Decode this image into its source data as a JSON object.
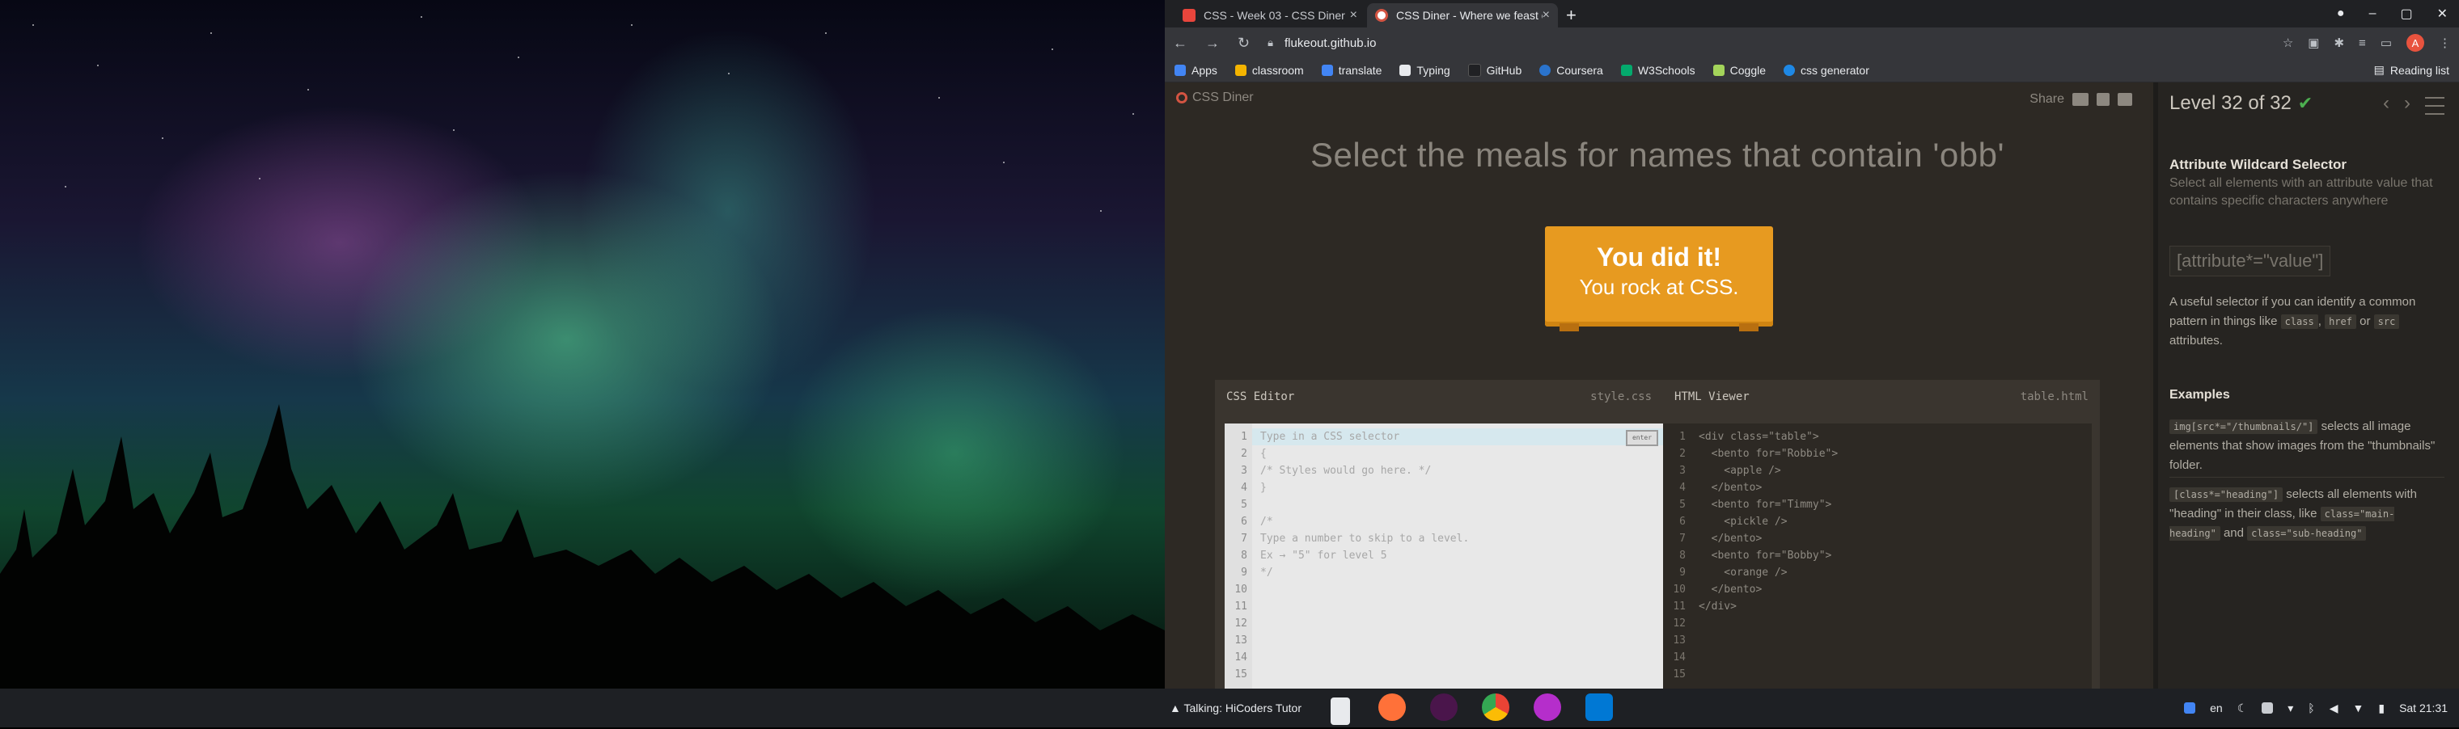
{
  "tabs": [
    {
      "title": "CSS - Week 03 - CSS Diner",
      "color": "#e8453c"
    },
    {
      "title": "CSS Diner - Where we feast on CSS",
      "color": "#d35442"
    }
  ],
  "toolbar": {
    "url": "flukeout.github.io",
    "avatar_letter": "A"
  },
  "bookmarks": [
    {
      "label": "Apps",
      "color": "#4285f4"
    },
    {
      "label": "classroom",
      "color": "#f4b400"
    },
    {
      "label": "translate",
      "color": "#4285f4"
    },
    {
      "label": "Typing",
      "color": "#e8eaed"
    },
    {
      "label": "GitHub",
      "color": "#202124"
    },
    {
      "label": "Coursera",
      "color": "#2a73cc"
    },
    {
      "label": "W3Schools",
      "color": "#04aa6d"
    },
    {
      "label": "Coggle",
      "color": "#a3d45a"
    },
    {
      "label": "css generator",
      "color": "#1e88e5"
    }
  ],
  "reading_list": "Reading list",
  "game": {
    "logo": "CSS Diner",
    "share": "Share",
    "order": "Select the meals for names that contain 'obb'",
    "win_line1": "You did it!",
    "win_line2": "You rock at CSS."
  },
  "editor": {
    "css_title": "CSS Editor",
    "css_file": "style.css",
    "html_title": "HTML Viewer",
    "html_file": "table.html",
    "enter_label": "enter",
    "css_lines": [
      "Type in a CSS selector",
      "{",
      "/* Styles would go here. */",
      "}",
      "",
      "/*",
      "Type a number to skip to a level.",
      "Ex → \"5\" for level 5",
      "*/",
      "",
      "",
      "",
      "",
      "",
      ""
    ],
    "html_lines": [
      "<div class=\"table\">",
      "  <bento for=\"Robbie\">",
      "    <apple />",
      "  </bento>",
      "  <bento for=\"Timmy\">",
      "    <pickle />",
      "  </bento>",
      "  <bento for=\"Bobby\">",
      "    <orange />",
      "  </bento>",
      "</div>",
      "",
      "",
      "",
      ""
    ],
    "gutter": [
      "1",
      "2",
      "3",
      "4",
      "5",
      "6",
      "7",
      "8",
      "9",
      "10",
      "11",
      "12",
      "13",
      "14",
      "15"
    ]
  },
  "sidebar": {
    "level": "Level 32 of 32",
    "title": "Attribute Wildcard Selector",
    "desc": "Select all elements with an attribute value that contains specific characters anywhere",
    "syntax": "[attribute*=\"value\"]",
    "hint_pre": "A useful selector if you can identify a common pattern in things like",
    "hint_c1": "class",
    "hint_mid1": ",",
    "hint_c2": "href",
    "hint_mid2": "or",
    "hint_c3": "src",
    "hint_post": "attributes.",
    "examples_title": "Examples",
    "ex1_code": "img[src*=\"/thumbnails/\"]",
    "ex1_text": "selects all image elements that show images from the \"thumbnails\" folder.",
    "ex2_code": "[class*=\"heading\"]",
    "ex2_text": "selects all elements with \"heading\" in their class, like",
    "ex2_c1": "class=\"main-heading\"",
    "ex2_and": "and",
    "ex2_c2": "class=\"sub-heading\""
  },
  "shelf": {
    "talking": "▲ Talking: HiCoders Tutor",
    "lang": "en",
    "date": "Sat 21:31"
  }
}
